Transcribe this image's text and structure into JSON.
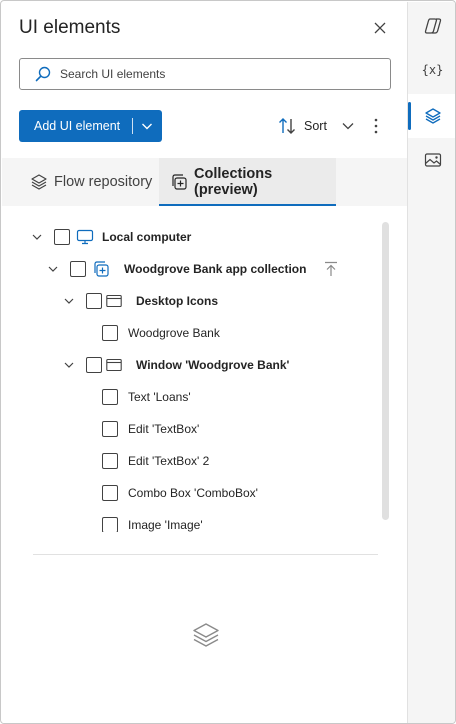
{
  "panel": {
    "title": "UI elements",
    "search": {
      "placeholder": "Search UI elements"
    },
    "toolbar": {
      "add_label": "Add UI element",
      "sort_label": "Sort"
    },
    "tabs": [
      {
        "label": "Flow repository",
        "active": false
      },
      {
        "label": "Collections (preview)",
        "active": true
      }
    ],
    "tree": [
      {
        "label": "Local computer",
        "level": 0,
        "expanded": true,
        "icon": "monitor-icon",
        "bold": true
      },
      {
        "label": "Woodgrove Bank app collection",
        "level": 1,
        "expanded": true,
        "icon": "collection-icon",
        "bold": true
      },
      {
        "label": "Desktop Icons",
        "level": 2,
        "expanded": true,
        "icon": "window-icon",
        "bold": true
      },
      {
        "label": "Woodgrove Bank",
        "level": 3,
        "icon": "none",
        "bold": false
      },
      {
        "label": "Window 'Woodgrove Bank'",
        "level": 2,
        "expanded": true,
        "icon": "window-icon",
        "bold": true
      },
      {
        "label": "Text 'Loans'",
        "level": 3,
        "icon": "none",
        "bold": false
      },
      {
        "label": "Edit 'TextBox'",
        "level": 3,
        "icon": "none",
        "bold": false
      },
      {
        "label": "Edit 'TextBox' 2",
        "level": 3,
        "icon": "none",
        "bold": false
      },
      {
        "label": "Combo Box 'ComboBox'",
        "level": 3,
        "icon": "none",
        "bold": false
      },
      {
        "label": "Image 'Image'",
        "level": 3,
        "icon": "none",
        "bold": false
      }
    ]
  },
  "rail": {
    "items": [
      {
        "icon": "copilot-icon",
        "label": ""
      },
      {
        "icon": "variables-icon",
        "label": "{x}"
      },
      {
        "icon": "layers-icon",
        "label": "",
        "active": true
      },
      {
        "icon": "images-icon",
        "label": ""
      }
    ]
  },
  "colors": {
    "accent": "#0f6cbd",
    "rail_bg": "#f5f5f5",
    "text": "#242424"
  }
}
